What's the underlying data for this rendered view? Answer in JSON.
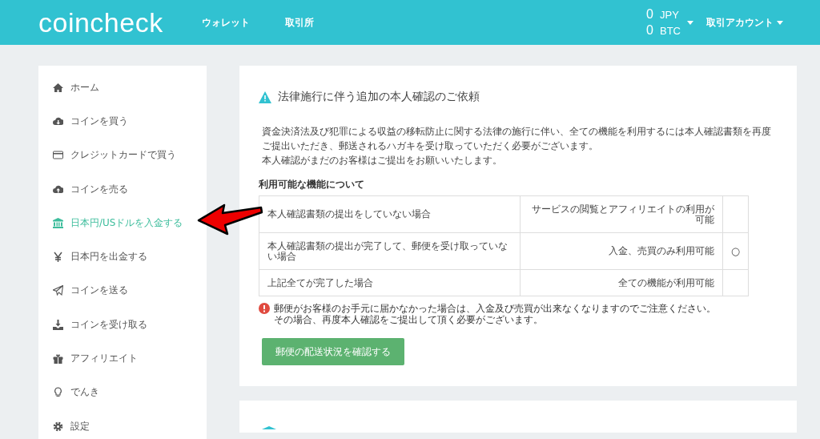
{
  "header": {
    "logo": "coincheck",
    "nav": [
      "ウォレット",
      "取引所"
    ],
    "balances": [
      {
        "amount": "0",
        "currency": "JPY"
      },
      {
        "amount": "0",
        "currency": "BTC"
      }
    ],
    "account_menu": "取引アカウント"
  },
  "sidebar": {
    "items": [
      {
        "label": "ホーム",
        "selected": false
      },
      {
        "label": "コインを買う",
        "selected": false
      },
      {
        "label": "クレジットカードで買う",
        "selected": false
      },
      {
        "label": "コインを売る",
        "selected": false
      },
      {
        "label": "日本円/USドルを入金する",
        "selected": true
      },
      {
        "label": "日本円を出金する",
        "selected": false
      },
      {
        "label": "コインを送る",
        "selected": false
      },
      {
        "label": "コインを受け取る",
        "selected": false
      },
      {
        "label": "アフィリエイト",
        "selected": false
      },
      {
        "label": "でんき",
        "selected": false
      },
      {
        "label": "設定",
        "selected": false
      }
    ]
  },
  "notice": {
    "title": "法律施行に伴う追加の本人確認のご依頼",
    "paragraphs": [
      "資金決済法及び犯罪による収益の移転防止に関する法律の施行に伴い、全ての機能を利用するには本人確認書類を再度ご提出いただき、郵送されるハガキを受け取っていただく必要がございます。",
      "本人確認がまだのお客様はご提出をお願いいたします。"
    ],
    "table_title": "利用可能な機能について",
    "table": {
      "rows": [
        {
          "column_1": "本人確認書類の提出をしていない場合",
          "column_2": "サービスの閲覧とアフィリエイトの利用が可能"
        },
        {
          "column_1": "本人確認書類の提出が完了して、郵便を受け取っていない場合",
          "column_2": "入金、売買のみ利用可能",
          "column_3": "○"
        },
        {
          "column_1": "上記全てが完了した場合",
          "column_2": "全ての機能が利用可能"
        }
      ]
    },
    "warning": [
      "郵便がお客様のお手元に届かなかった場合は、入金及び売買が出来なくなりますのでご注意ください。",
      "その場合、再度本人確認をご提出して頂く必要がございます。"
    ],
    "button": "郵便の配送状況を確認する"
  }
}
